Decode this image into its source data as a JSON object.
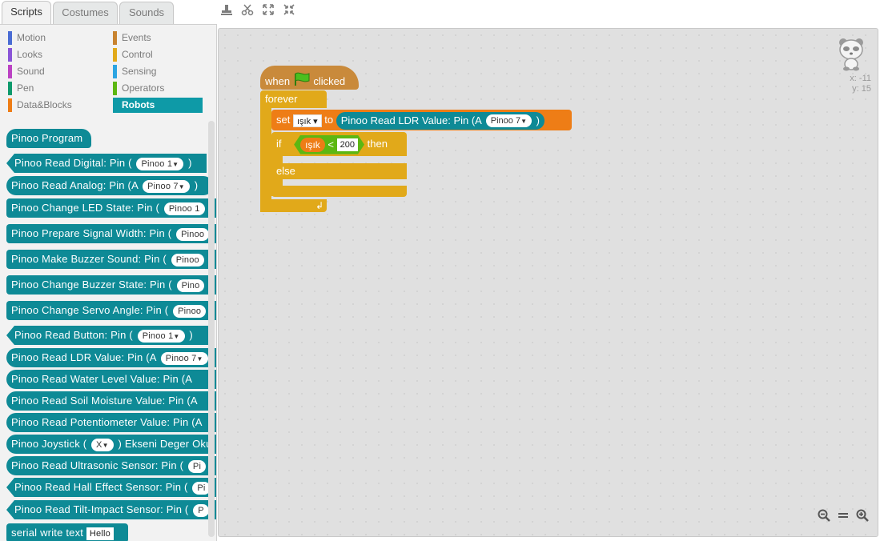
{
  "tabs": [
    "Scripts",
    "Costumes",
    "Sounds"
  ],
  "toolbar": {
    "icons": [
      "stamp-icon",
      "scissors-icon",
      "grow-icon",
      "shrink-icon"
    ]
  },
  "categories": [
    {
      "label": "Motion",
      "color": "#4a6cd4"
    },
    {
      "label": "Looks",
      "color": "#8a55d7"
    },
    {
      "label": "Sound",
      "color": "#bb42c3"
    },
    {
      "label": "Pen",
      "color": "#0e9a6c"
    },
    {
      "label": "Data&Blocks",
      "color": "#ee7d16"
    },
    {
      "label": "Events",
      "color": "#c88330"
    },
    {
      "label": "Control",
      "color": "#e1a91a"
    },
    {
      "label": "Sensing",
      "color": "#2ca5e2"
    },
    {
      "label": "Operators",
      "color": "#5cb712"
    },
    {
      "label": "Robots",
      "color": "#0e9aa7"
    }
  ],
  "palette": {
    "program": "Pinoo Program",
    "read_digital": {
      "label": "Pinoo Read Digital: Pin (",
      "pin": "Pinoo 1",
      "end": ")"
    },
    "read_analog": {
      "label": "Pinoo Read Analog: Pin (A",
      "pin": "Pinoo 7",
      "end": ")"
    },
    "change_led": {
      "label": "Pinoo Change LED State: Pin (",
      "pin": "Pinoo 1"
    },
    "prepare_signal": {
      "label": "Pinoo Prepare Signal Width: Pin (",
      "pin": "Pinoo"
    },
    "make_buzzer": {
      "label": "Pinoo Make Buzzer Sound: Pin (",
      "pin": "Pinoo"
    },
    "change_buzzer": {
      "label": "Pinoo Change Buzzer State: Pin (",
      "pin": "Pino"
    },
    "change_servo": {
      "label": "Pinoo Change Servo Angle: Pin (",
      "pin": "Pinoo"
    },
    "read_button": {
      "label": "Pinoo Read Button: Pin (",
      "pin": "Pinoo 1",
      "end": ")"
    },
    "read_ldr": {
      "label": "Pinoo Read LDR Value: Pin (A",
      "pin": "Pinoo 7"
    },
    "read_water": {
      "label": "Pinoo Read Water Level Value: Pin (A"
    },
    "read_soil": {
      "label": "Pinoo Read Soil Moisture Value: Pin (A"
    },
    "read_pot": {
      "label": "Pinoo Read Potentiometer Value: Pin (A"
    },
    "joystick": {
      "label1": "Pinoo Joystick (",
      "axis": "X",
      "label2": ") Ekseni Deger Oku"
    },
    "read_ultrasonic": {
      "label": "Pinoo Read Ultrasonic Sensor: Pin (",
      "pin": "Pi"
    },
    "read_hall": {
      "label": "Pinoo Read Hall Effect Sensor: Pin (",
      "pin": "Pi"
    },
    "read_tilt": {
      "label": "Pinoo Read Tilt-Impact Sensor: Pin (",
      "pin": "P"
    },
    "serial_write": {
      "label": "serial write text",
      "value": "Hello"
    }
  },
  "script": {
    "hat": {
      "when": "when",
      "clicked": "clicked"
    },
    "forever": "forever",
    "set": {
      "label": "set",
      "var": "ışık",
      "to": "to",
      "reporter": "Pinoo Read LDR Value: Pin (A",
      "pin": "Pinoo 7",
      "end": ")"
    },
    "if": {
      "label": "if",
      "var": "ışık",
      "op": "<",
      "value": "200",
      "then": "then"
    },
    "else": "else"
  },
  "sprite": {
    "x_label": "x:",
    "x": "-11",
    "y_label": "y:",
    "y": "15"
  },
  "zoom": {
    "icons": [
      "zoom-out-icon",
      "zoom-reset-icon",
      "zoom-in-icon"
    ]
  }
}
